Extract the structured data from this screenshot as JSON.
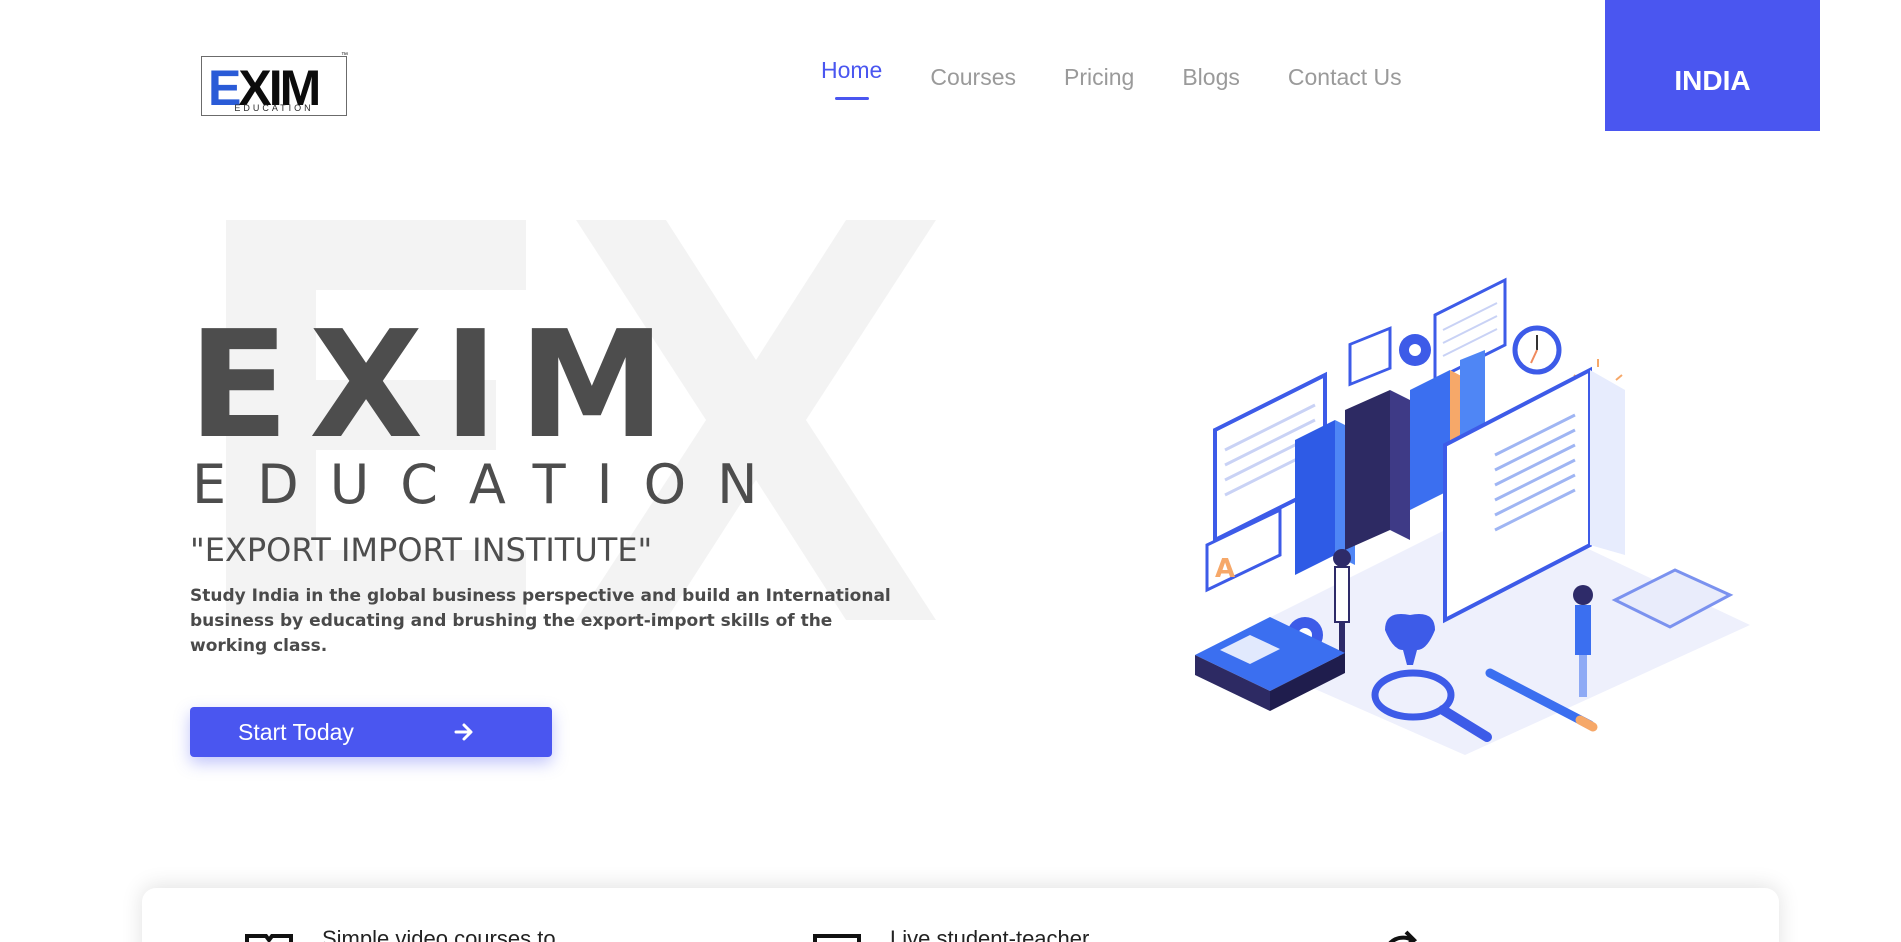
{
  "header": {
    "logo": {
      "word": "EXIM",
      "sub": "EDUCATION",
      "tm": "™"
    },
    "nav": [
      {
        "label": "Home",
        "active": true
      },
      {
        "label": "Courses",
        "active": false
      },
      {
        "label": "Pricing",
        "active": false
      },
      {
        "label": "Blogs",
        "active": false
      },
      {
        "label": "Contact Us",
        "active": false
      }
    ],
    "country_button": "INDIA"
  },
  "hero": {
    "brand": "EXIM",
    "brand_sub": "EDUCATION",
    "tagline": "\"EXPORT IMPORT INSTITUTE\"",
    "description": "Study India in the global business perspective and build an International business by educating and brushing the export-import skills of the working class.",
    "cta_label": "Start Today"
  },
  "features": [
    {
      "text": "Simple video courses to",
      "icon": "book-open-icon"
    },
    {
      "text": "Live student-teacher",
      "icon": "monitor-icon"
    },
    {
      "text": "",
      "icon": "refresh-icon"
    }
  ],
  "colors": {
    "accent": "#4a56f0",
    "text": "#4d4d4d",
    "nav_inactive": "#9a9a9a"
  }
}
